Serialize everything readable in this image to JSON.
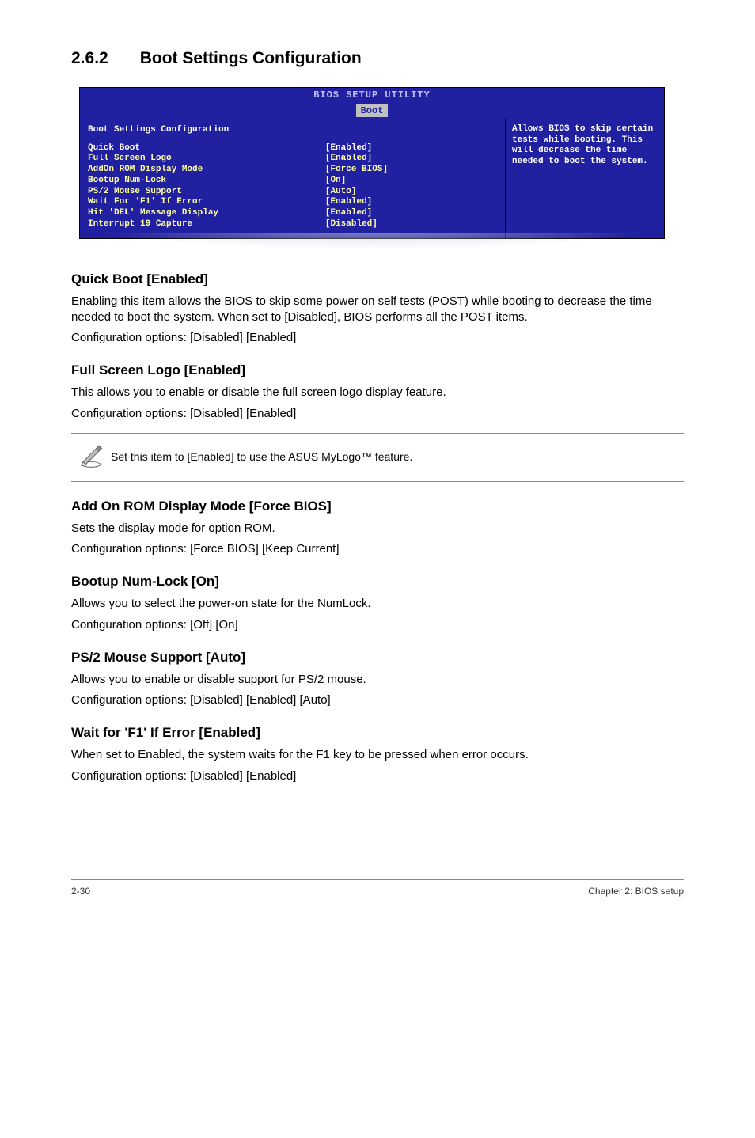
{
  "section": {
    "number": "2.6.2",
    "title": "Boot Settings Configuration"
  },
  "bios": {
    "window_title": "BIOS SETUP UTILITY",
    "active_tab": "Boot",
    "panel_heading": "Boot Settings Configuration",
    "help_text": "Allows BIOS to skip certain tests while booting. This will decrease the time needed to boot the system.",
    "items": [
      {
        "label": "Quick Boot",
        "value": "[Enabled]"
      },
      {
        "label": "Full Screen Logo",
        "value": "[Enabled]"
      },
      {
        "label": "AddOn ROM Display Mode",
        "value": "[Force BIOS]"
      },
      {
        "label": "Bootup Num-Lock",
        "value": "[On]"
      },
      {
        "label": "PS/2 Mouse Support",
        "value": "[Auto]"
      },
      {
        "label": "Wait For 'F1' If Error",
        "value": "[Enabled]"
      },
      {
        "label": "Hit 'DEL' Message Display",
        "value": "[Enabled]"
      },
      {
        "label": "Interrupt 19 Capture",
        "value": "[Disabled]"
      }
    ]
  },
  "quick_boot": {
    "heading": "Quick Boot [Enabled]",
    "p1": "Enabling this item allows the BIOS to skip some power on self tests (POST) while booting to decrease the time needed to boot the system. When set to [Disabled], BIOS performs all the POST items.",
    "p2": "Configuration options: [Disabled] [Enabled]"
  },
  "full_screen_logo": {
    "heading": "Full Screen Logo [Enabled]",
    "p1": "This allows you to enable or disable the full screen logo display feature.",
    "p2": "Configuration options: [Disabled] [Enabled]"
  },
  "note": {
    "text": "Set this item to [Enabled] to use the ASUS MyLogo™ feature."
  },
  "addon_rom": {
    "heading": "Add On ROM Display Mode [Force BIOS]",
    "p1": "Sets the display mode for option ROM.",
    "p2": "Configuration options: [Force BIOS] [Keep Current]"
  },
  "bootup_numlock": {
    "heading": "Bootup Num-Lock [On]",
    "p1": "Allows you to select the power-on state for the NumLock.",
    "p2": "Configuration options: [Off] [On]"
  },
  "ps2_mouse": {
    "heading": "PS/2 Mouse Support [Auto]",
    "p1": "Allows you to enable or disable support for PS/2 mouse.",
    "p2": "Configuration options: [Disabled] [Enabled] [Auto]"
  },
  "wait_f1": {
    "heading": "Wait for 'F1' If Error [Enabled]",
    "p1": "When set to Enabled, the system waits for the F1 key to be pressed when error occurs.",
    "p2": "Configuration options: [Disabled] [Enabled]"
  },
  "footer": {
    "page": "2-30",
    "chapter": "Chapter 2: BIOS setup"
  }
}
